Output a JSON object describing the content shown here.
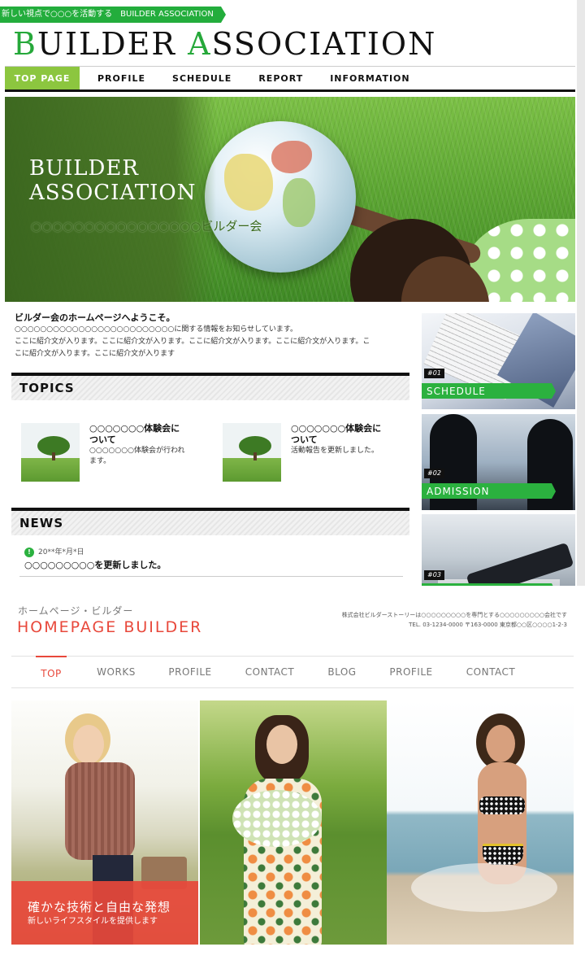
{
  "site1": {
    "tagline": "新しい視点で○○○を活動する　BUILDER ASSOCIATION",
    "logo": {
      "part1_initial": "B",
      "part1_rest": "UILDER ",
      "part2_initial": "A",
      "part2_rest": "SSOCIATION"
    },
    "nav": [
      "TOP PAGE",
      "PROFILE",
      "SCHEDULE",
      "REPORT",
      "INFORMATION"
    ],
    "hero": {
      "title": "BUILDER\nASSOCIATION",
      "subtitle": "○○○○○○○○○○○○○○○○ビルダー会"
    },
    "welcome": {
      "heading": "ビルダー会のホームページへようこそ。",
      "line1": "○○○○○○○○○○○○○○○○○○○○○○○○○に関する情報をお知らせしています。",
      "line2": "ここに紹介文が入ります。ここに紹介文が入ります。ここに紹介文が入ります。ここに紹介文が入ります。こ",
      "line3": "こに紹介文が入ります。ここに紹介文が入ります"
    },
    "topics_heading": "TOPICS",
    "topics": [
      {
        "title": "○○○○○○○体験会に\nついて",
        "text": "○○○○○○○体験会が行われ\nます。"
      },
      {
        "title": "○○○○○○○体験会に\nついて",
        "text": "活動報告を更新しました。"
      }
    ],
    "news_heading": "NEWS",
    "news": {
      "date": "20**年*月*日",
      "text": "○○○○○○○○○を更新しました。"
    },
    "side_cards": [
      {
        "num": "#01",
        "label": "SCHEDULE"
      },
      {
        "num": "#02",
        "label": "ADMISSION"
      },
      {
        "num": "#03",
        "label": ""
      }
    ],
    "accent_color": "#2bb13f"
  },
  "site2": {
    "small_title": "ホームページ・ビルダー",
    "title": "HOMEPAGE BUILDER",
    "info_line1": "株式会社ビルダーストーリーは○○○○○○○○○を専門とする○○○○○○○○○会社です",
    "info_line2": "TEL. 03-1234-0000 〒163-0000 東京都○○区○○○○1-2-3",
    "nav": [
      "TOP",
      "WORKS",
      "PROFILE",
      "CONTACT",
      "BLOG",
      "PROFILE",
      "CONTACT"
    ],
    "caption_main": "確かな技術と自由な発想",
    "caption_sub": "新しいライフスタイルを提供します",
    "accent_color": "#e8483b"
  }
}
